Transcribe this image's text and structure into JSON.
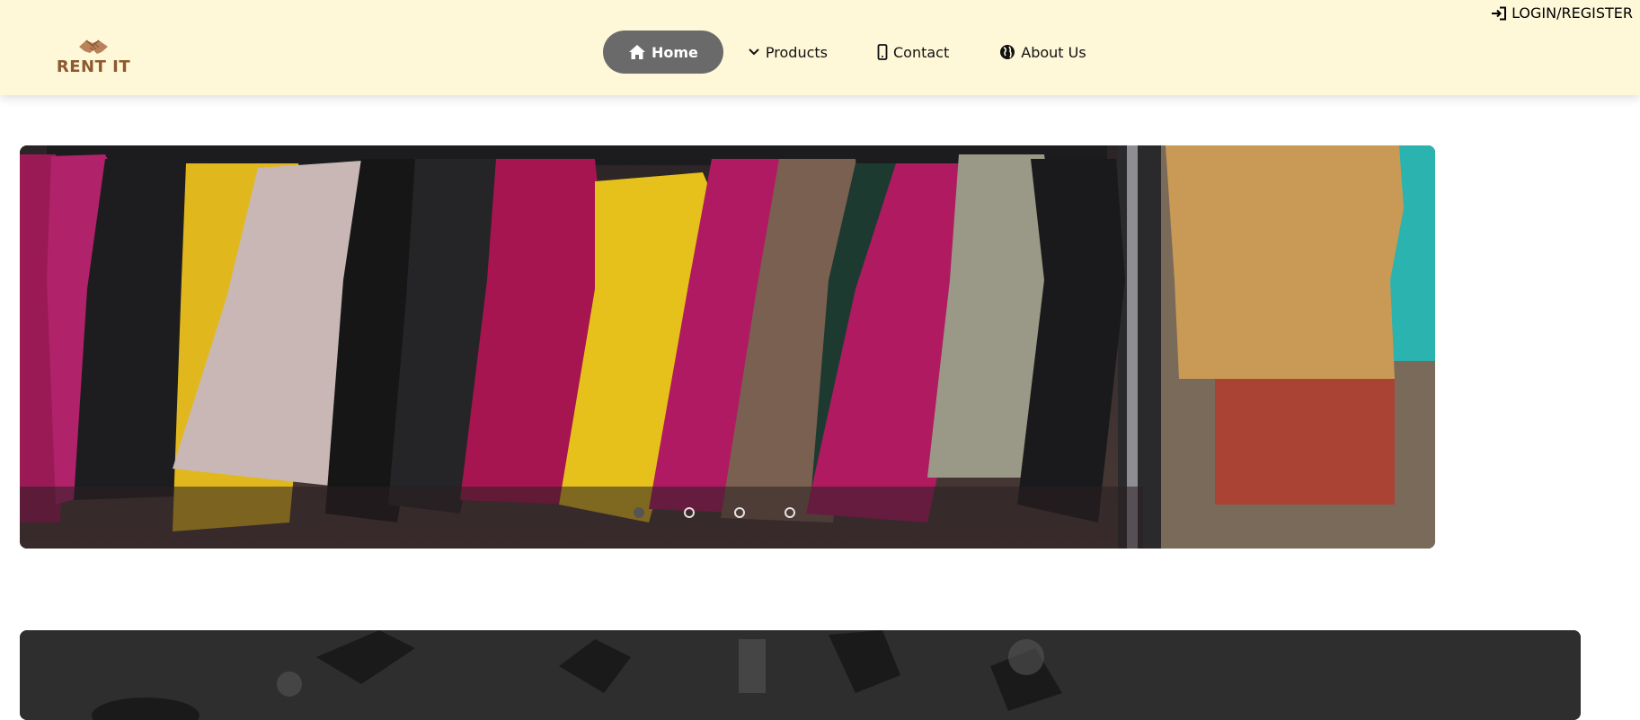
{
  "header": {
    "logo_text": "RENT IT",
    "logo_icon": "handshake-icon",
    "login_label": "LOGIN/REGISTER",
    "login_icon": "sign-in-icon"
  },
  "nav": {
    "items": [
      {
        "label": "Home",
        "icon": "home-icon"
      },
      {
        "label": "Products",
        "icon": "chevron-down-icon"
      },
      {
        "label": "Contact",
        "icon": "mobile-phone-icon"
      },
      {
        "label": "About Us",
        "icon": "globe-icon"
      }
    ],
    "active_index": 0
  },
  "carousel": {
    "image": "leather-jackets-on-rack",
    "slide_count": 4,
    "active_slide": 1
  },
  "banner2": {
    "image": "dark-grayscale-photo"
  },
  "colors": {
    "header_bg": "#fef7d8",
    "active_pill": "#6a6a6a",
    "brand": "#8c5a2e"
  }
}
